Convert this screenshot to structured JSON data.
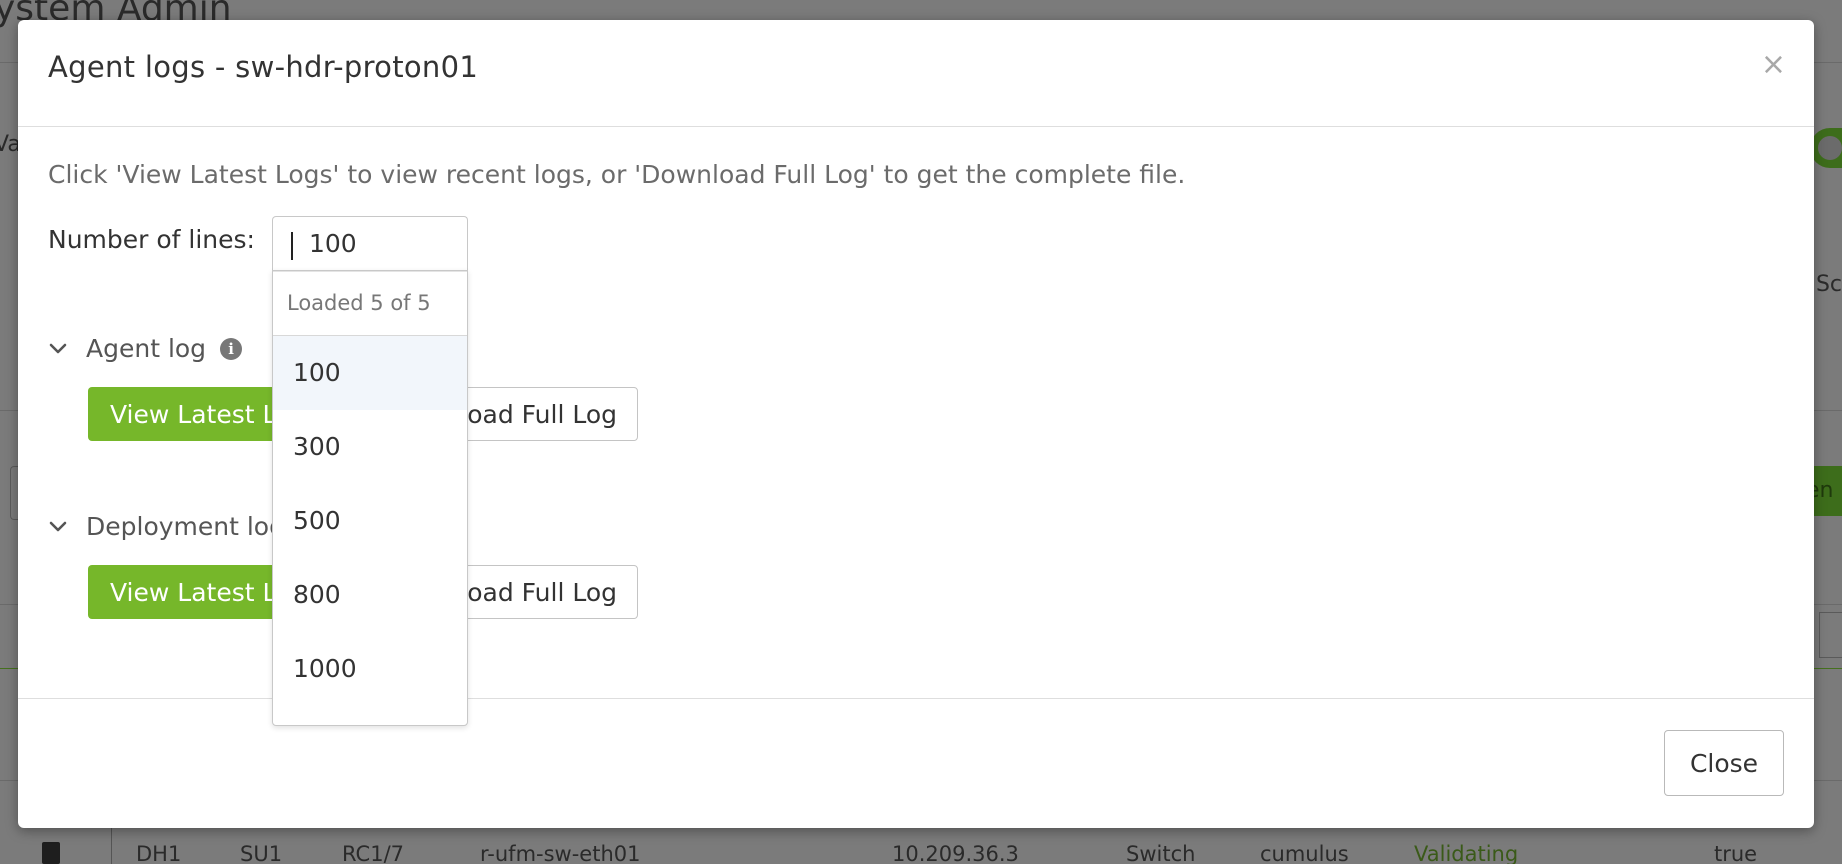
{
  "background": {
    "page_title": "ystem Admin",
    "left_fragment": "Va",
    "right_fragment": "Sc",
    "right_button_fragment": "en",
    "row": {
      "c1": "DH1",
      "c2": "SU1",
      "c3": "RC1/7",
      "c4": "r-ufm-sw-eth01",
      "c5": "10.209.36.3",
      "c6": "Switch",
      "c7": "cumulus",
      "c8": "Validating",
      "c9": "true"
    }
  },
  "modal": {
    "title": "Agent logs - sw-hdr-proton01",
    "close_icon": "×",
    "instructions": "Click 'View Latest Logs' to view recent logs, or 'Download Full Log' to get the complete file.",
    "lines_label": "Number of lines:",
    "select": {
      "value": "100",
      "status": "Loaded 5 of 5",
      "options": [
        "100",
        "300",
        "500",
        "800",
        "1000"
      ]
    },
    "sections": [
      {
        "title": "Agent log",
        "info_icon": "i",
        "view_label": "View Latest Logs",
        "download_label": "Download Full Log"
      },
      {
        "title": "Deployment log",
        "view_label": "View Latest Logs",
        "download_label": "Download Full Log"
      }
    ],
    "footer": {
      "close_label": "Close"
    }
  },
  "colors": {
    "accent_green": "#76b72a",
    "overlay": "#7b7b7b"
  }
}
